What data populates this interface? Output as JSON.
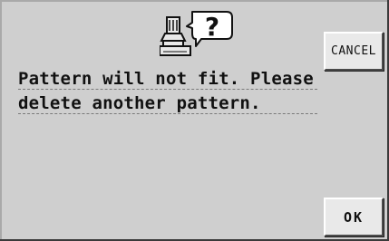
{
  "dialog": {
    "icon": "machine-question-icon",
    "message_lines": [
      "Pattern will not fit. Please",
      "delete another pattern."
    ]
  },
  "buttons": {
    "cancel_label": "CANCEL",
    "ok_label": "OK"
  },
  "colors": {
    "panel_background": "#cfcfcf",
    "button_face": "#e9e9e9",
    "text": "#111111"
  }
}
